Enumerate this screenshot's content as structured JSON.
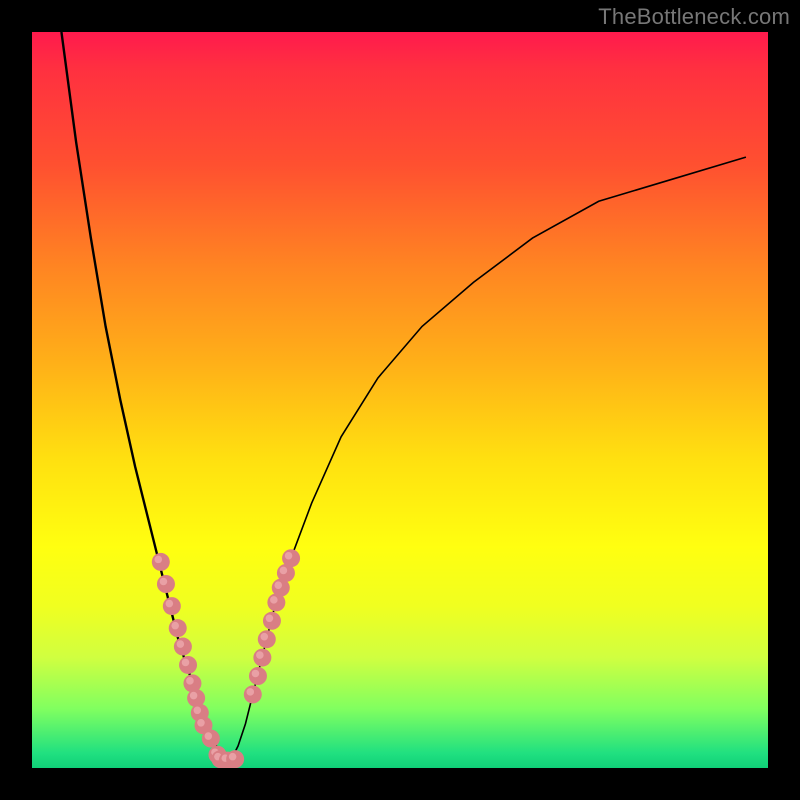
{
  "watermark_text": "TheBottleneck.com",
  "chart_data": {
    "type": "line",
    "title": "",
    "xlabel": "",
    "ylabel": "",
    "xlim": [
      0,
      100
    ],
    "ylim": [
      0,
      100
    ],
    "grid": false,
    "legend": null,
    "gradient_note": "background encodes value: red=high near top, green=low near bottom (bottleneck valley visualization)",
    "series": [
      {
        "name": "left_branch",
        "x": [
          4,
          6,
          8,
          10,
          12,
          14,
          16,
          18,
          19,
          20,
          21,
          22,
          23,
          24,
          25,
          26
        ],
        "values": [
          100,
          85,
          72,
          60,
          50,
          41,
          33,
          25,
          21,
          17,
          14,
          11,
          8,
          5,
          3,
          1
        ]
      },
      {
        "name": "right_branch",
        "x": [
          27,
          28,
          29,
          30,
          31,
          32,
          33,
          35,
          38,
          42,
          47,
          53,
          60,
          68,
          77,
          87,
          97
        ],
        "values": [
          1,
          3,
          6,
          10,
          14,
          18,
          22,
          28,
          36,
          45,
          53,
          60,
          66,
          72,
          77,
          80,
          83
        ]
      },
      {
        "name": "valley_floor",
        "x": [
          25,
          26,
          27,
          28
        ],
        "values": [
          1,
          0.5,
          0.5,
          1
        ]
      }
    ],
    "scatter_points": {
      "name": "marked_data_points",
      "x": [
        17.5,
        18.2,
        19.0,
        19.8,
        20.5,
        21.2,
        21.8,
        22.3,
        22.8,
        23.3,
        24.3,
        25.2,
        25.6,
        26.6,
        27.6,
        30.0,
        30.7,
        31.3,
        31.9,
        32.6,
        33.2,
        33.8,
        34.5,
        35.2
      ],
      "values": [
        28.0,
        25.0,
        22.0,
        19.0,
        16.5,
        14.0,
        11.5,
        9.5,
        7.5,
        5.8,
        4.0,
        1.8,
        1.2,
        1.0,
        1.2,
        10.0,
        12.5,
        15.0,
        17.5,
        20.0,
        22.5,
        24.5,
        26.5,
        28.5
      ],
      "point_color": "#d97e84",
      "point_radius_px": 9
    }
  }
}
